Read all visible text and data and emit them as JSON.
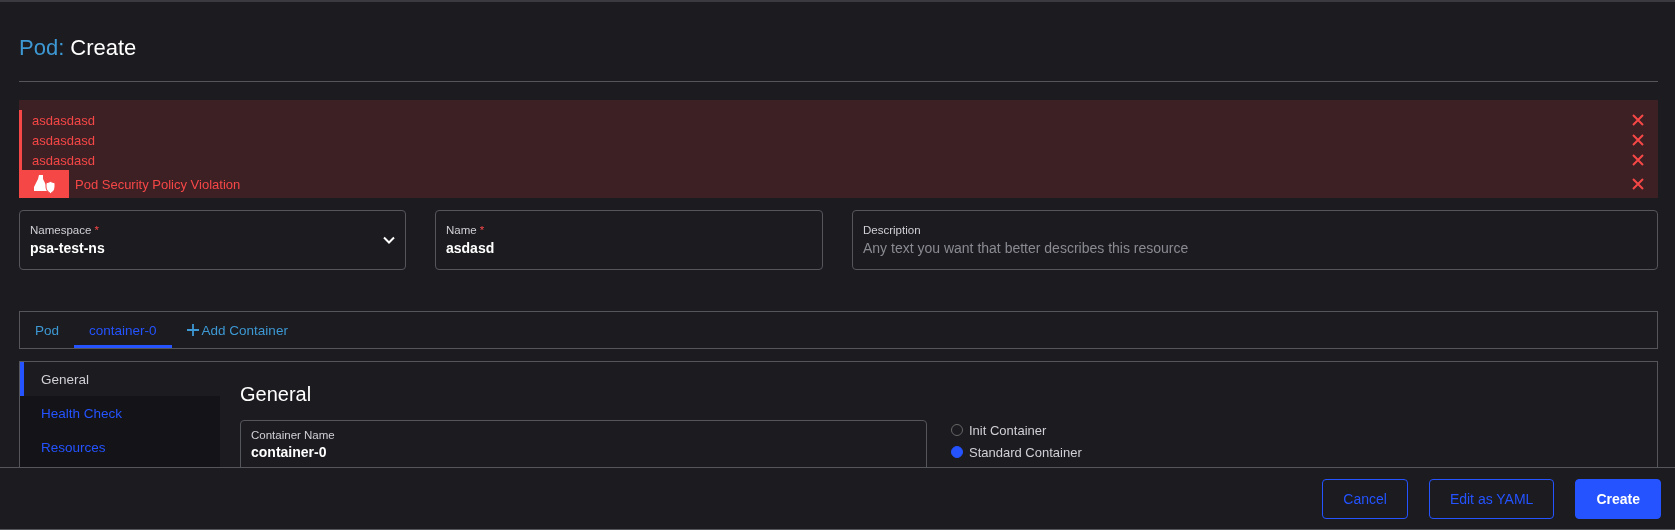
{
  "title": {
    "resource": "Pod:",
    "action": "Create"
  },
  "banner": {
    "messages": [
      "asdasdasd",
      "asdasdasd",
      "asdasdasd"
    ],
    "violation": "Pod Security Policy Violation"
  },
  "fields": [
    {
      "kind": "select",
      "label": "Namespace",
      "required_mark": "*",
      "value": "psa-test-ns"
    },
    {
      "kind": "text",
      "label": "Name",
      "required_mark": "*",
      "value": "asdasd"
    },
    {
      "kind": "text",
      "label": "Description",
      "placeholder": "Any text you want that better describes this resource"
    }
  ],
  "tabs": [
    {
      "kind": "tab",
      "label": "Pod",
      "selected": false
    },
    {
      "kind": "tab",
      "label": "container-0",
      "selected": true
    },
    {
      "kind": "add",
      "label": "Add Container",
      "selected": false
    }
  ],
  "side_nav": [
    {
      "label": "General",
      "selected": true
    },
    {
      "label": "Health Check",
      "selected": false
    },
    {
      "label": "Resources",
      "selected": false
    }
  ],
  "section": {
    "heading": "General",
    "container_name": {
      "label": "Container Name",
      "value": "container-0"
    },
    "container_type": [
      {
        "label": "Init Container",
        "selected": false
      },
      {
        "label": "Standard Container",
        "selected": true
      }
    ]
  },
  "buttons": [
    {
      "kind": "secondary",
      "label": "Cancel"
    },
    {
      "kind": "secondary",
      "label": "Edit as YAML"
    },
    {
      "kind": "primary",
      "label": "Create"
    }
  ]
}
